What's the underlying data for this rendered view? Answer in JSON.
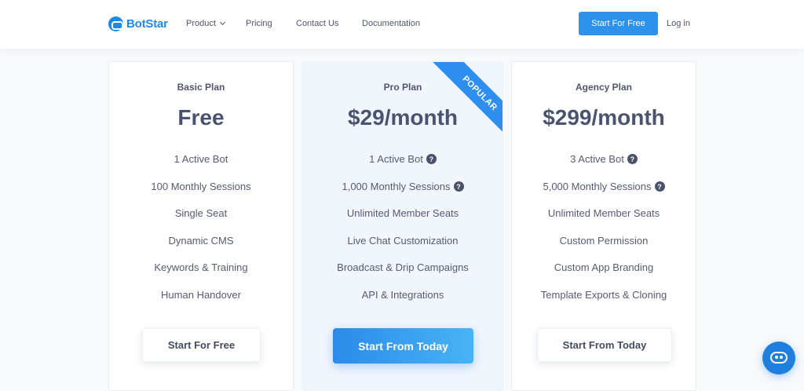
{
  "brand": {
    "name": "BotStar",
    "accent": "#1e88e5"
  },
  "nav": {
    "product": "Product",
    "pricing": "Pricing",
    "contact": "Contact Us",
    "documentation": "Documentation",
    "cta": "Start For Free",
    "login": "Log in"
  },
  "plans": [
    {
      "name": "Basic Plan",
      "price": "Free",
      "features": [
        "1 Active Bot",
        "100 Monthly Sessions",
        "Single Seat",
        "Dynamic CMS",
        "Keywords & Training",
        "Human Handover"
      ],
      "button": "Start For Free"
    },
    {
      "name": "Pro Plan",
      "price": "$29/month",
      "badge": "POPULAR",
      "features": [
        "1 Active Bot",
        "1,000 Monthly Sessions",
        "Unlimited Member Seats",
        "Live Chat Customization",
        "Broadcast & Drip Campaigns",
        "API & Integrations"
      ],
      "button": "Start From Today"
    },
    {
      "name": "Agency Plan",
      "price": "$299/month",
      "features": [
        "3 Active Bot",
        "5,000 Monthly Sessions",
        "Unlimited Member Seats",
        "Custom Permission",
        "Custom App Branding",
        "Template Exports & Cloning"
      ],
      "button": "Start From Today"
    }
  ],
  "help_glyph": "?",
  "chat_widget": {
    "icon": "chat-bot-icon"
  }
}
